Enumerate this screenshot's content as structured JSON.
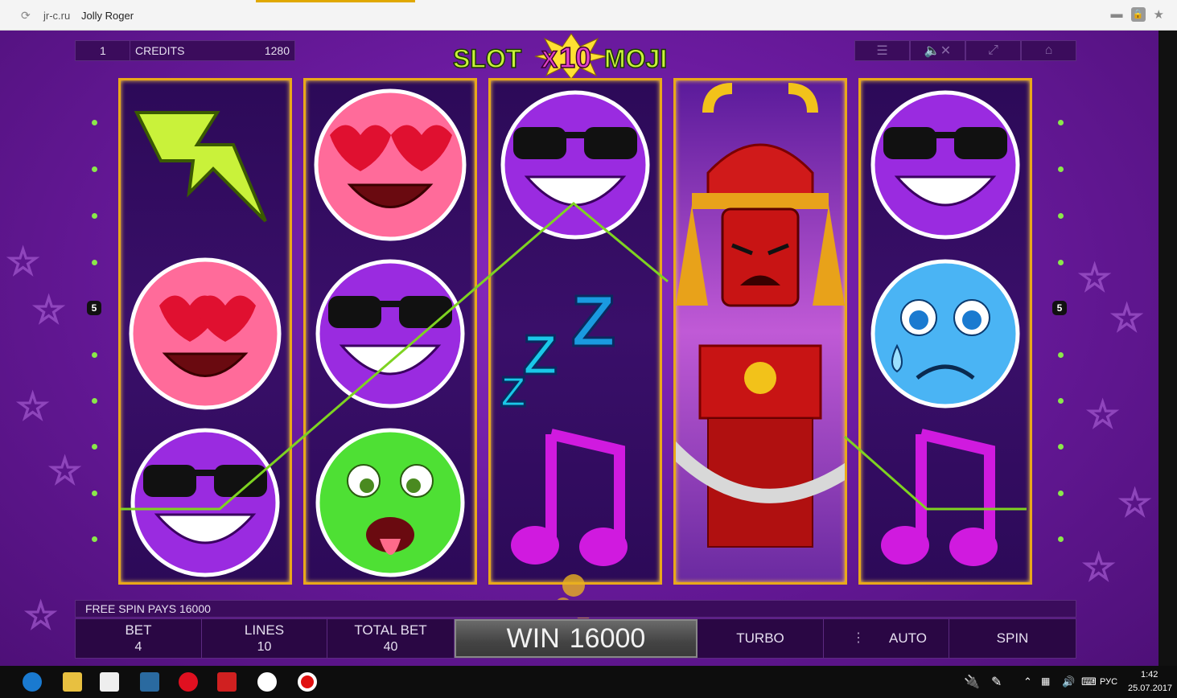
{
  "browser": {
    "domain": "jr-c.ru",
    "title": "Jolly Roger"
  },
  "game": {
    "logo": {
      "left": "SLOT",
      "x": "X",
      "ten": "10",
      "right": "MOJI"
    },
    "hud": {
      "bet_level": "1",
      "credits_label": "CREDITS",
      "credits_value": "1280"
    },
    "top_buttons": [
      "menu-icon",
      "mute-icon",
      "fullscreen-icon",
      "home-icon"
    ],
    "line_marker_left": "5",
    "line_marker_right": "5",
    "reels": [
      [
        "lightning",
        "heart-eyes",
        "cool-sunglasses"
      ],
      [
        "heart-eyes",
        "cool-sunglasses",
        "sick-green"
      ],
      [
        "cool-sunglasses",
        "sleep-zzz",
        "music-note"
      ],
      [
        "samurai-wild",
        "samurai-wild",
        "samurai-wild"
      ],
      [
        "cool-sunglasses",
        "crying-blue",
        "music-note"
      ]
    ],
    "free_spin_text": "FREE SPIN PAYS 16000",
    "bottom": {
      "bet_label": "BET",
      "bet_value": "4",
      "lines_label": "LINES",
      "lines_value": "10",
      "total_label": "TOTAL BET",
      "total_value": "40",
      "win_label": "WIN",
      "win_value": "16000",
      "turbo": "TURBO",
      "auto": "AUTO",
      "spin": "SPIN"
    },
    "colors": {
      "reel_border": "#e9a81a",
      "payline": "#7ed321",
      "background": "#6a1a9e"
    }
  },
  "taskbar": {
    "apps": [
      "edge-icon",
      "file-explorer-icon",
      "store-icon",
      "display-icon",
      "opera-icon",
      "yandex-icon",
      "yandex-browser-icon",
      "record-icon"
    ],
    "language": "РУС",
    "time": "1:42",
    "date": "25.07.2017"
  }
}
